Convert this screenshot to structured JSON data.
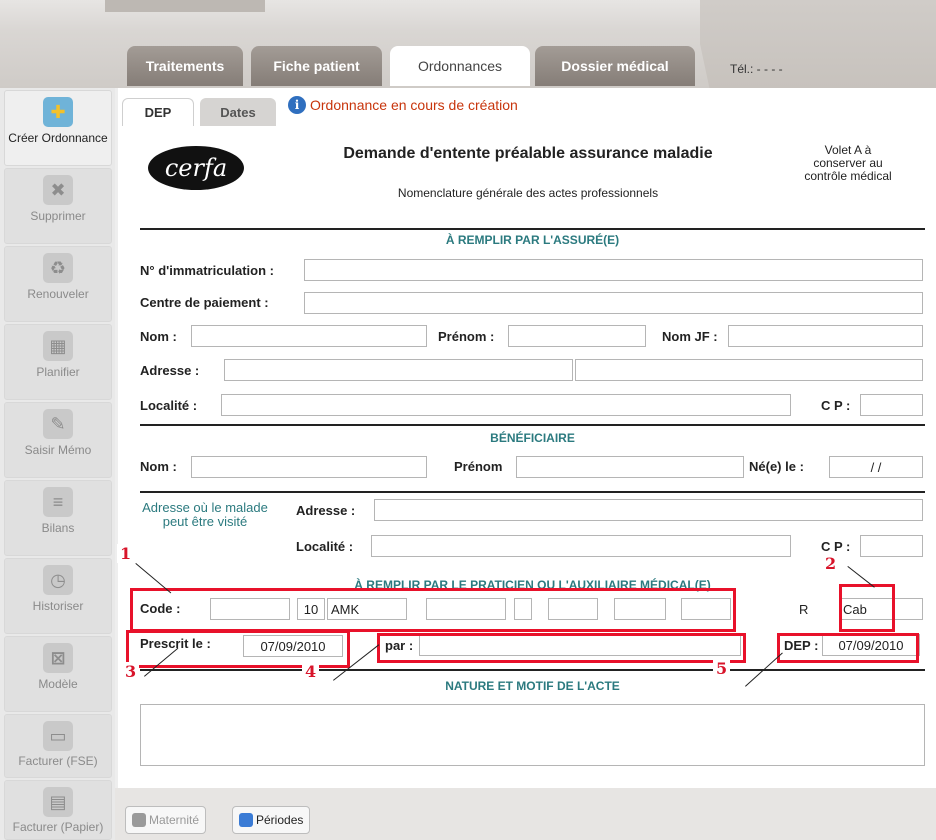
{
  "main_tabs": [
    "Traitements",
    "Fiche patient",
    "Ordonnances",
    "Dossier médical"
  ],
  "tel": "Tél.:  - - - -",
  "sub_tabs": [
    "DEP",
    "Dates"
  ],
  "status": "Ordonnance en cours de création",
  "sidebar": [
    {
      "label": "Créer Ordonnance",
      "icon": "create-prescription-icon"
    },
    {
      "label": "Supprimer",
      "icon": "delete-icon"
    },
    {
      "label": "Renouveler",
      "icon": "renew-icon"
    },
    {
      "label": "Planifier",
      "icon": "calendar-icon"
    },
    {
      "label": "Saisir Mémo",
      "icon": "memo-icon"
    },
    {
      "label": "Bilans",
      "icon": "report-icon"
    },
    {
      "label": "Historiser",
      "icon": "history-icon"
    },
    {
      "label": "Modèle",
      "icon": "template-icon"
    },
    {
      "label": "Facturer (FSE)",
      "icon": "card-reader-icon"
    },
    {
      "label": "Facturer (Papier)",
      "icon": "paper-invoice-icon"
    }
  ],
  "form": {
    "logo": "cerfa",
    "title": "Demande d'entente préalable assurance maladie",
    "subtitle": "Nomenclature générale des actes professionnels",
    "volet": "Volet A à conserver au contrôle médical",
    "section_assure": "À REMPLIR PAR L'ASSURÉ(E)",
    "immatriculation": "N° d'immatriculation :",
    "centre": "Centre de paiement :",
    "nom": "Nom :",
    "prenom": "Prénom :",
    "nomjf": "Nom JF :",
    "adresse": "Adresse :",
    "localite": "Localité :",
    "cp": "C P :",
    "section_benef": "BÉNÉFICIAIRE",
    "prenom2": "Prénom",
    "ne_le": "Né(e) le :",
    "birth_value": "/ /",
    "visit_address": "Adresse où le malade peut être visité",
    "cp_partial": "C P :",
    "section_praticien": "À REMPLIR PAR LE PRATICIEN OU L'AUXILIAIRE MÉDICAL(E)",
    "code_label": "Code :",
    "code_coef": "10",
    "code_act": "AMK",
    "code_r": "R",
    "code_cab": "Cab",
    "prescrit_label": "Prescrit le :",
    "prescrit_value": "07/09/2010",
    "par_label": "par :",
    "dep_label": "DEP :",
    "dep_value": "07/09/2010",
    "section_nature": "NATURE ET MOTIF DE L'ACTE"
  },
  "annotations": [
    "1",
    "2",
    "3",
    "4",
    "5"
  ],
  "bottom_buttons": [
    "Maternité",
    "Périodes"
  ],
  "colors": {
    "accent_red": "#e8112a",
    "section_teal": "#2b7a7f",
    "status_orange": "#c8350c"
  }
}
